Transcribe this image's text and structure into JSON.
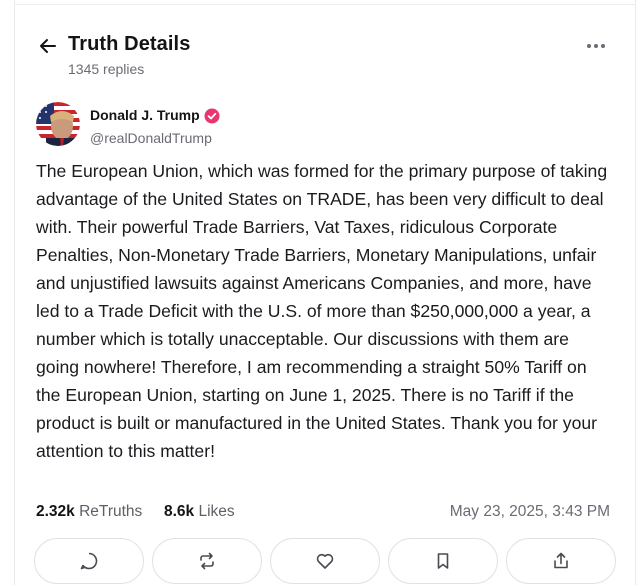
{
  "header": {
    "title": "Truth Details",
    "replies": "1345 replies"
  },
  "author": {
    "name": "Donald J. Trump",
    "handle": "@realDonaldTrump",
    "verified_color": "#e8366f"
  },
  "post": {
    "text": "The European Union, which was formed for the primary purpose of taking advantage of the United States on TRADE, has been very difficult to deal with. Their powerful Trade Barriers, Vat Taxes, ridiculous Corporate Penalties, Non-Monetary Trade Barriers, Monetary Manipulations, unfair and unjustified lawsuits against Americans Companies, and more, have led to a Trade Deficit with the U.S. of more than $250,000,000 a year, a number which is totally unacceptable. Our discussions with them are going nowhere! Therefore, I am recommending a straight 50% Tariff on the European Union, starting on June 1, 2025. There is no Tariff if the product is built or manufactured in the United States. Thank you for your attention to this matter!"
  },
  "stats": {
    "retruths_count": "2.32k",
    "retruths_label": "ReTruths",
    "likes_count": "8.6k",
    "likes_label": "Likes",
    "timestamp": "May 23, 2025, 3:43 PM"
  },
  "actions": [
    {
      "icon": "reply-icon"
    },
    {
      "icon": "retruth-icon"
    },
    {
      "icon": "like-icon"
    },
    {
      "icon": "bookmark-icon"
    },
    {
      "icon": "share-icon"
    }
  ]
}
